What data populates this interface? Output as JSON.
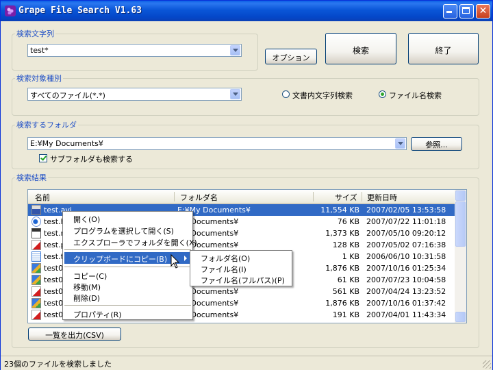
{
  "window": {
    "title": "Grape File Search  V1.63"
  },
  "search_string": {
    "label": "検索文字列",
    "value": "test*"
  },
  "buttons": {
    "options": "オプション",
    "search": "検索",
    "exit": "終了",
    "browse": "参照...",
    "export_csv": "一覧を出力(CSV)"
  },
  "search_type": {
    "label": "検索対象種別",
    "value": "すべてのファイル(*.*)",
    "radio_content": "文書内文字列検索",
    "radio_filename": "ファイル名検索",
    "selected": "ファイル名検索"
  },
  "folder": {
    "label": "検索するフォルダ",
    "value": "E:¥My Documents¥",
    "subfolder_label": "サブフォルダも検索する",
    "subfolder_checked": true
  },
  "results": {
    "label": "検索結果",
    "columns": {
      "name": "名前",
      "folder": "フォルダ名",
      "size": "サイズ",
      "date": "更新日時"
    },
    "rows": [
      {
        "name": "test.avi",
        "folder": "E:¥My Documents¥",
        "size": "11,554 KB",
        "date": "2007/02/05 13:53:58",
        "icon": "avi-file-icon"
      },
      {
        "name": "test.h",
        "folder": "My Documents¥",
        "size": "76 KB",
        "date": "2007/07/22 11:01:18",
        "icon": "html-file-icon"
      },
      {
        "name": "test.m",
        "folder": "My Documents¥",
        "size": "1,373 KB",
        "date": "2007/05/10 09:20:12",
        "icon": "media-file-icon"
      },
      {
        "name": "test.p",
        "folder": "My Documents¥",
        "size": "128 KB",
        "date": "2007/05/02 07:16:38",
        "icon": "pdf-file-icon"
      },
      {
        "name": "test.t",
        "folder": "My Documents¥",
        "size": "1 KB",
        "date": "2006/06/10 10:31:58",
        "icon": "text-file-icon"
      },
      {
        "name": "test0",
        "folder": "My Documents¥",
        "size": "1,876 KB",
        "date": "2007/10/16 01:25:34",
        "icon": "image-file-icon"
      },
      {
        "name": "test0",
        "folder": "My Documents¥",
        "size": "61 KB",
        "date": "2007/07/23 10:04:58",
        "icon": "image-file-icon"
      },
      {
        "name": "test0",
        "folder": "My Documents¥",
        "size": "561 KB",
        "date": "2007/04/24 13:23:52",
        "icon": "pdf-file-icon"
      },
      {
        "name": "test0",
        "folder": "My Documents¥",
        "size": "1,876 KB",
        "date": "2007/10/16 01:37:42",
        "icon": "image-file-icon"
      },
      {
        "name": "test0",
        "folder": "My Documents¥",
        "size": "191 KB",
        "date": "2007/04/01 11:43:34",
        "icon": "pdf-file-icon"
      }
    ]
  },
  "context_menu": {
    "open": "開く(O)",
    "open_with": "プログラムを選択して開く(S)",
    "open_folder": "エクスプローラでフォルダを開く(X)",
    "copy_clipboard": "クリップボードにコピー(B)",
    "copy": "コピー(C)",
    "move": "移動(M)",
    "delete": "削除(D)",
    "properties": "プロパティ(R)"
  },
  "submenu": {
    "folder_name": "フォルダ名(O)",
    "file_name": "ファイル名(I)",
    "full_path": "ファイル名(フルパス)(P)"
  },
  "status": {
    "text": "23個のファイルを検索しました"
  },
  "colors": {
    "titlebar": "#0a56d8",
    "selection": "#316ac5",
    "group_label": "#1f4fc6",
    "face": "#ece9d8"
  }
}
